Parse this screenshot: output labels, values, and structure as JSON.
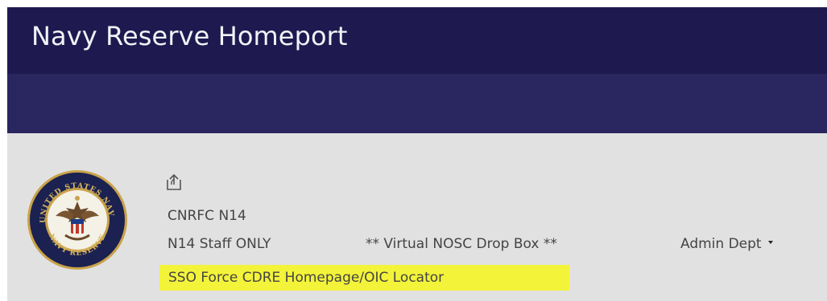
{
  "suite_bar": {
    "title": "Navy Reserve Homeport"
  },
  "site": {
    "title": "CNRFC N14",
    "logo_text_top": "UNITED STATES NAVY",
    "logo_text_bottom": "NAVY RESERVE"
  },
  "nav": {
    "items": [
      {
        "label": "N14 Staff ONLY"
      },
      {
        "label": "** Virtual NOSC Drop Box **"
      },
      {
        "label": "Admin Dept"
      }
    ],
    "highlighted": {
      "label": "SSO Force CDRE Homepage/OIC Locator"
    }
  },
  "colors": {
    "suite_bar": "#1e1a50",
    "sub_bar": "#2a2660",
    "content_bg": "#e1e1e1",
    "highlight": "#f3f33a",
    "text": "#444444"
  },
  "icons": {
    "share": "share-icon",
    "logo": "navy-reserve-seal-icon",
    "dropdown": "caret-down-icon"
  }
}
